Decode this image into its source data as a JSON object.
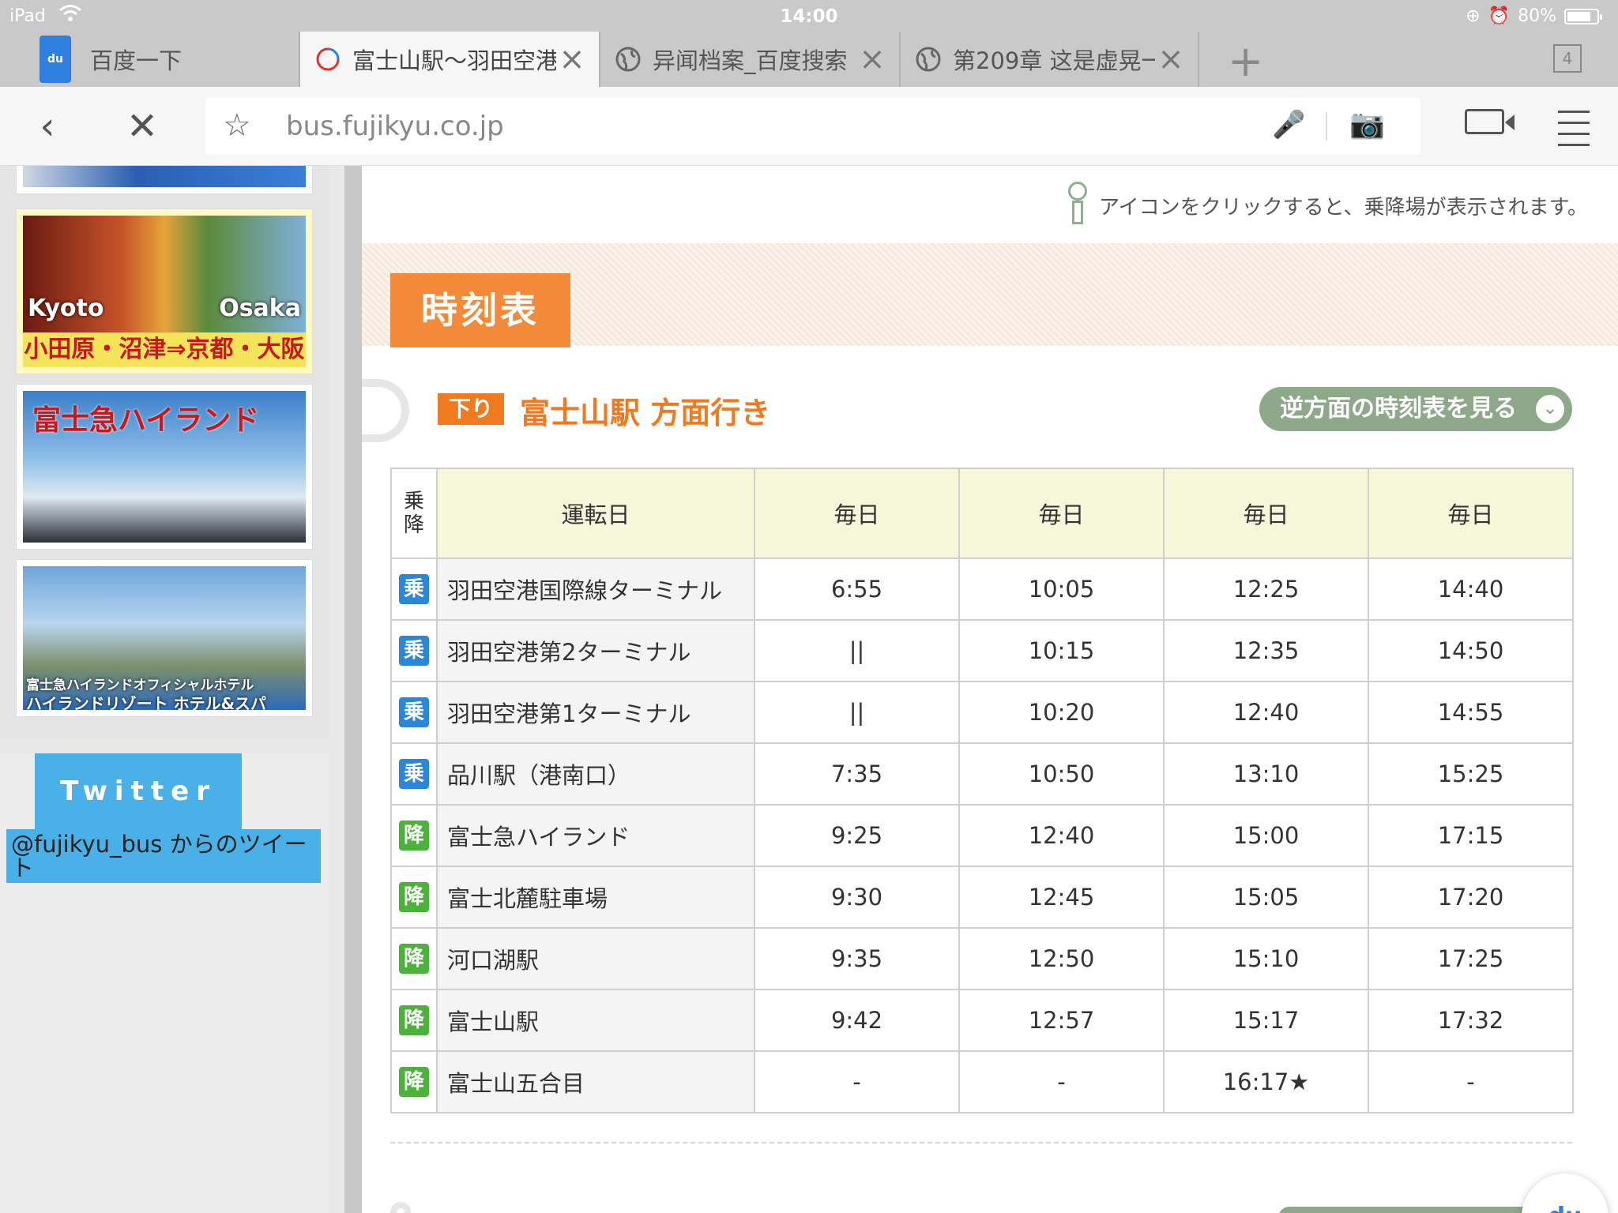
{
  "status_bar": {
    "device": "iPad",
    "time": "14:00",
    "battery_percent_label": "80%",
    "battery_level": 0.8
  },
  "tabs": [
    {
      "title": "百度一下",
      "icon": "baidu-paw-icon",
      "active": false
    },
    {
      "title": "富士山駅～羽田空港",
      "icon": "loading-spinner-icon",
      "active": true
    },
    {
      "title": "异闻档案_百度搜索",
      "icon": "globe-icon",
      "active": false
    },
    {
      "title": "第209章 这是虚晃一",
      "icon": "globe-icon",
      "active": false
    }
  ],
  "tab_count": "4",
  "address_bar": {
    "url": "bus.fujikyu.co.jp"
  },
  "sidebar": {
    "banners": [
      {
        "name": "bus-banner",
        "texts": []
      },
      {
        "name": "kyoto-osaka-banner",
        "texts": [
          "Kyoto",
          "Osaka",
          "小田原・沼津⇒京都・大阪"
        ]
      },
      {
        "name": "highland-banner",
        "texts": [
          "富士急ハイランド"
        ]
      },
      {
        "name": "highland-hotel-banner",
        "texts": [
          "富士急ハイランドオフィシャルホテル",
          "ハイランドリゾート ホテル&スパ"
        ]
      }
    ],
    "twitter": {
      "button_label": "Twitter",
      "link_text": "@fujikyu_bus からのツイート"
    }
  },
  "content": {
    "notice": "アイコンをクリックすると、乗降場が表示されます。",
    "section_title": "時刻表",
    "direction_badge": "下り",
    "direction_title": "富士山駅 方面行き",
    "reverse_button": "逆方面の時刻表を見る",
    "table": {
      "headers": [
        "乗降",
        "運転日",
        "毎日",
        "毎日",
        "毎日",
        "毎日"
      ],
      "rows": [
        {
          "type": "乗",
          "kind": "board",
          "stop": "羽田空港国際線ターミナル",
          "times": [
            "6:55",
            "10:05",
            "12:25",
            "14:40"
          ]
        },
        {
          "type": "乗",
          "kind": "board",
          "stop": "羽田空港第2ターミナル",
          "times": [
            "||",
            "10:15",
            "12:35",
            "14:50"
          ]
        },
        {
          "type": "乗",
          "kind": "board",
          "stop": "羽田空港第1ターミナル",
          "times": [
            "||",
            "10:20",
            "12:40",
            "14:55"
          ]
        },
        {
          "type": "乗",
          "kind": "board",
          "stop": "品川駅（港南口）",
          "times": [
            "7:35",
            "10:50",
            "13:10",
            "15:25"
          ]
        },
        {
          "type": "降",
          "kind": "alight",
          "stop": "富士急ハイランド",
          "times": [
            "9:25",
            "12:40",
            "15:00",
            "17:15"
          ]
        },
        {
          "type": "降",
          "kind": "alight",
          "stop": "富士北麓駐車場",
          "times": [
            "9:30",
            "12:45",
            "15:05",
            "17:20"
          ]
        },
        {
          "type": "降",
          "kind": "alight",
          "stop": "河口湖駅",
          "times": [
            "9:35",
            "12:50",
            "15:10",
            "17:25"
          ]
        },
        {
          "type": "降",
          "kind": "alight",
          "stop": "富士山駅",
          "times": [
            "9:42",
            "12:57",
            "15:17",
            "17:32"
          ]
        },
        {
          "type": "降",
          "kind": "alight",
          "stop": "富士山五合目",
          "times": [
            "-",
            "-",
            "16:17★",
            "-"
          ]
        }
      ]
    }
  },
  "colors": {
    "accent_orange": "#f28a3a",
    "board_blue": "#2a86d8",
    "alight_green": "#4cb33a",
    "twitter_blue": "#4ab0e8",
    "reverse_button_green": "#8ea98a"
  }
}
